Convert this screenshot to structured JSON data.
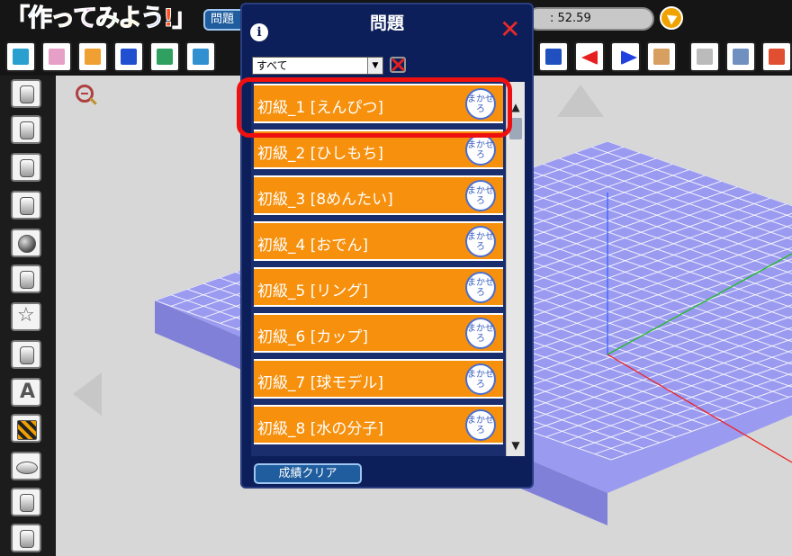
{
  "app": {
    "logo_text": "「作ってみよう!」",
    "problem_tab": "問題",
    "timer_value": ": 52.59"
  },
  "dialog": {
    "title": "問題",
    "filter_selected": "すべて",
    "items": [
      {
        "label": "初級_1 [えんぴつ]",
        "badge": "まかせろ"
      },
      {
        "label": "初級_2 [ひしもち]",
        "badge": "まかせろ"
      },
      {
        "label": "初級_3 [8めんたい]",
        "badge": "まかせろ"
      },
      {
        "label": "初級_4 [おでん]",
        "badge": "まかせろ"
      },
      {
        "label": "初級_5 [リング]",
        "badge": "まかせろ"
      },
      {
        "label": "初級_6 [カップ]",
        "badge": "まかせろ"
      },
      {
        "label": "初級_7 [球モデル]",
        "badge": "まかせろ"
      },
      {
        "label": "初級_8 [水の分子]",
        "badge": "まかせろ"
      }
    ],
    "reset_button": "成績クリア"
  },
  "colors": {
    "item_bg": "#f6900d",
    "panel_bg": "#0d1f5a",
    "highlight": "#ee1010",
    "grid_fill": "#9a9af0"
  }
}
